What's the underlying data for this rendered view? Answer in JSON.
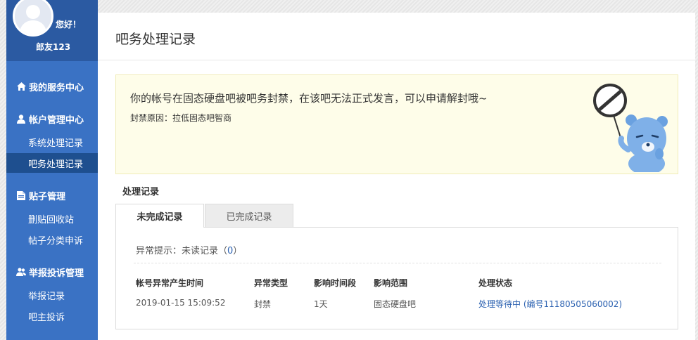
{
  "user": {
    "greeting": "您好！",
    "name": "郎友123"
  },
  "sidebar": {
    "service_center": "我的服务中心",
    "account_mgmt": {
      "title": "帐户管理中心",
      "items": [
        "系统处理记录",
        "吧务处理记录"
      ]
    },
    "post_mgmt": {
      "title": "贴子管理",
      "items": [
        "删贴回收站",
        "帖子分类申诉"
      ]
    },
    "report_mgmt": {
      "title": "举报投诉管理",
      "items": [
        "举报记录",
        "吧主投诉"
      ]
    },
    "active_item": "吧务处理记录"
  },
  "main": {
    "title": "吧务处理记录",
    "notice": {
      "message": "你的帐号在固态硬盘吧被吧务封禁，在该吧无法正式发言，可以申请解封哦~",
      "reason": "封禁原因：拉低固态吧智商"
    },
    "section_title": "处理记录",
    "tabs": [
      "未完成记录",
      "已完成记录"
    ],
    "alert": {
      "label": "异常提示：未读记录（",
      "count": "0",
      "suffix": "）"
    },
    "table": {
      "headers": [
        "帐号异常产生时间",
        "异常类型",
        "影响时间段",
        "影响范围",
        "处理状态"
      ],
      "rows": [
        [
          "2019-01-15 15:09:52",
          "封禁",
          "1天",
          "固态硬盘吧",
          "处理等待中 (编号11180505060002)"
        ]
      ]
    }
  },
  "colors": {
    "sidebar": "#3a72c4",
    "sidebar_dark": "#2b5aa2",
    "active_item": "#1e4f8f",
    "link": "#2a60b0",
    "notice_bg": "#fefde9"
  },
  "icons": {
    "service": "home-icon",
    "account": "user-icon",
    "post": "document-icon",
    "report": "users-icon",
    "mascot": "bear-ban-sign"
  }
}
